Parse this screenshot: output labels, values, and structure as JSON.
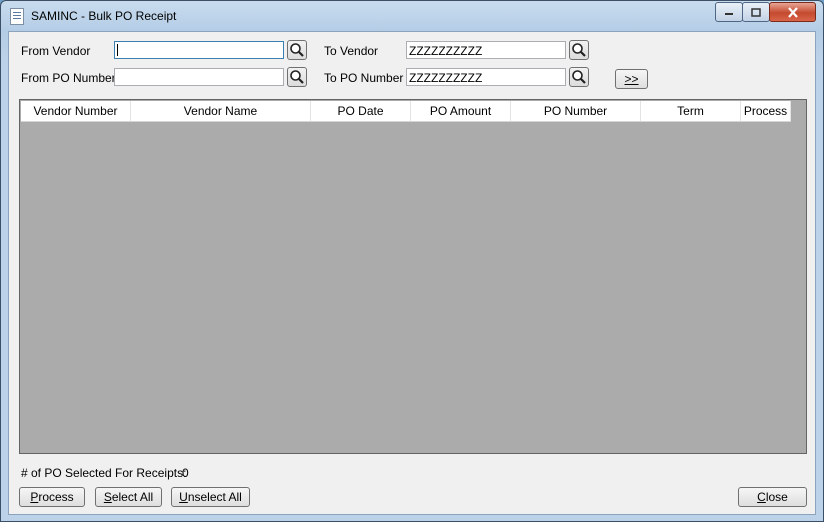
{
  "window": {
    "title": "SAMINC - Bulk PO Receipt",
    "controls": [
      "minimize-icon",
      "maximize-icon",
      "close-icon"
    ]
  },
  "filters": {
    "from_vendor_label": "From Vendor",
    "from_vendor_value": "",
    "to_vendor_label": "To Vendor",
    "to_vendor_value": "ZZZZZZZZZZ",
    "from_po_label": "From PO Number",
    "from_po_value": "",
    "to_po_label": "To PO Number",
    "to_po_value": "ZZZZZZZZZZ",
    "lookup_icon": "search-icon",
    "go_label": ">>"
  },
  "grid": {
    "columns": [
      "Vendor Number",
      "Vendor Name",
      "PO Date",
      "PO Amount",
      "PO Number",
      "Term",
      "Process"
    ],
    "rows": []
  },
  "summary": {
    "label": "# of PO Selected For Receipts:",
    "count": "0"
  },
  "buttons": {
    "process_mnemonic": "P",
    "process_rest": "rocess",
    "select_all_mnemonic": "S",
    "select_all_rest": "elect All",
    "unselect_all_mnemonic": "U",
    "unselect_all_rest": "nselect All",
    "close_mnemonic": "C",
    "close_rest": "lose"
  },
  "colors": {
    "grid_background": "#ababab",
    "window_frame": "#b4cde6",
    "client_background": "#f0f0f0"
  }
}
